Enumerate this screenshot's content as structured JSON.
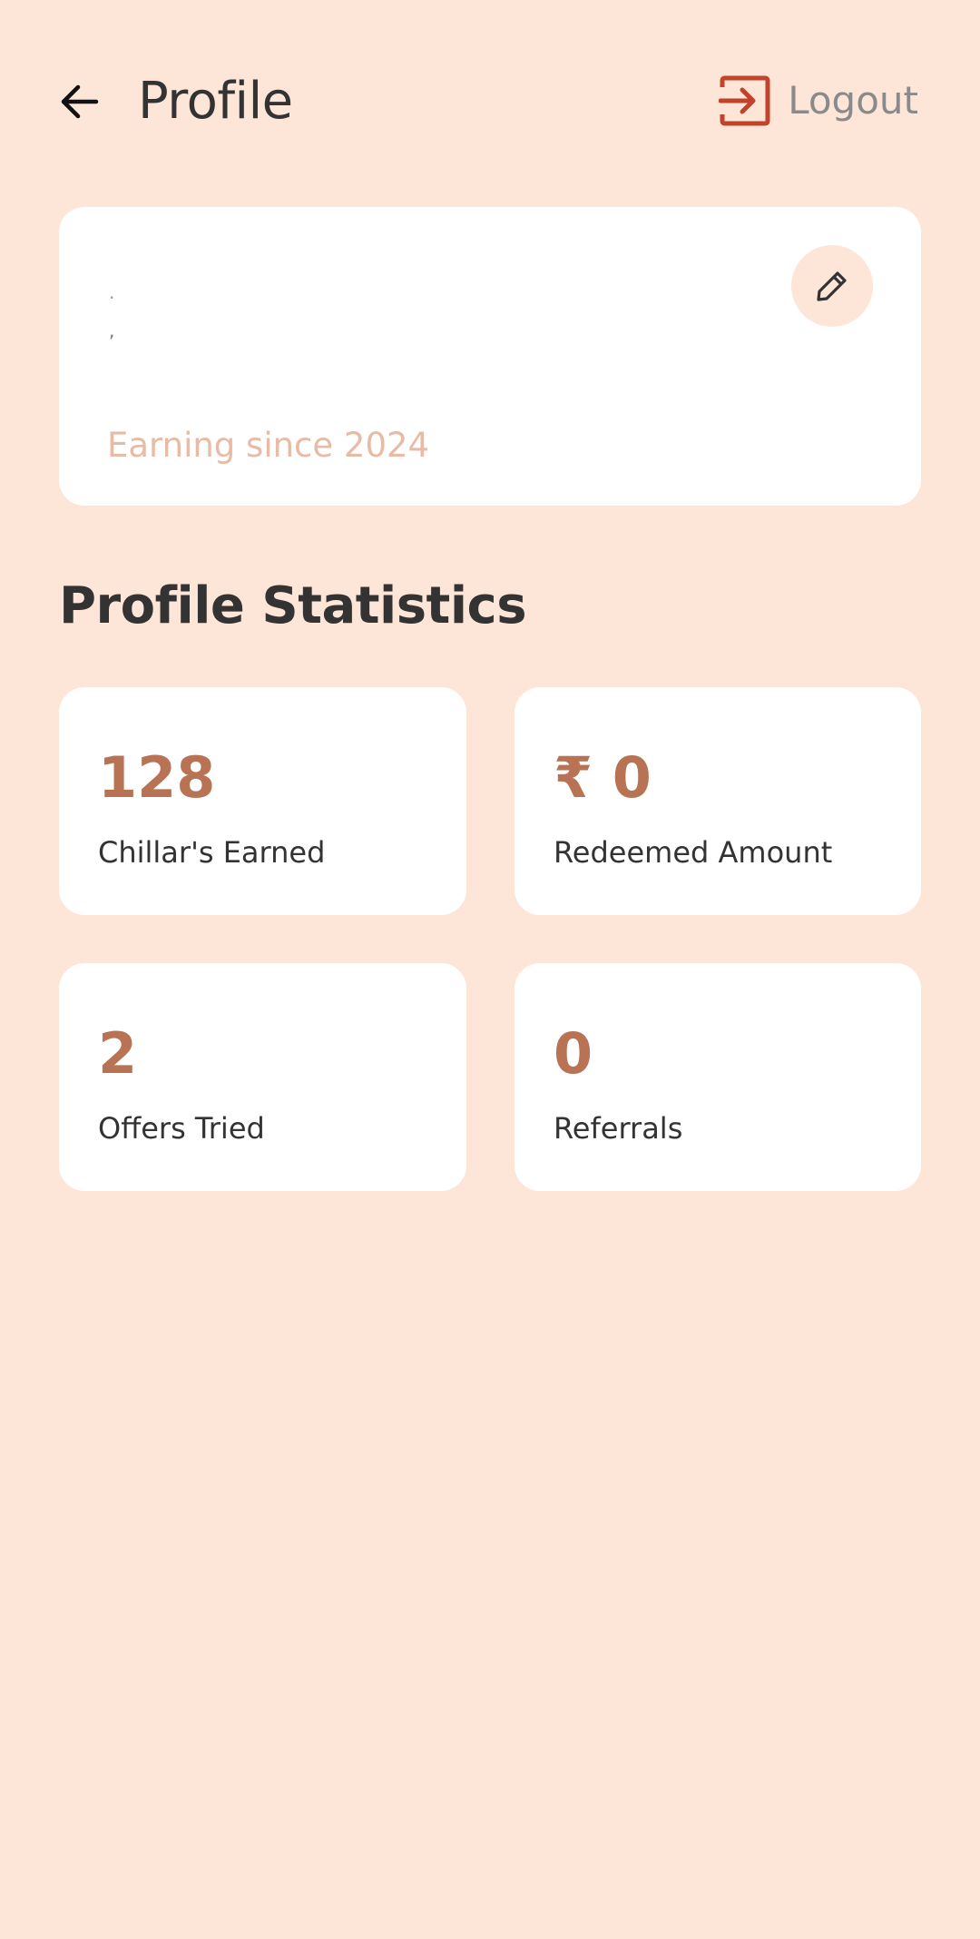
{
  "header": {
    "back_icon": "arrow-left-icon",
    "title": "Profile",
    "logout_icon": "logout-icon",
    "logout_label": "Logout",
    "logout_icon_color": "#c0432a"
  },
  "profile_card": {
    "name": "·",
    "handle": ",",
    "edit_icon": "pencil-icon",
    "earning_since": "Earning since 2024"
  },
  "statistics": {
    "title": "Profile Statistics",
    "items": [
      {
        "value": "128",
        "label": "Chillar's Earned"
      },
      {
        "value": "₹ 0",
        "label": "Redeemed Amount"
      },
      {
        "value": "2",
        "label": "Offers Tried"
      },
      {
        "value": "0",
        "label": "Referrals"
      }
    ]
  },
  "colors": {
    "background": "#fde6d8",
    "card": "#ffffff",
    "accent": "#b87355",
    "muted_accent": "#e7bba6",
    "text": "#333333"
  }
}
